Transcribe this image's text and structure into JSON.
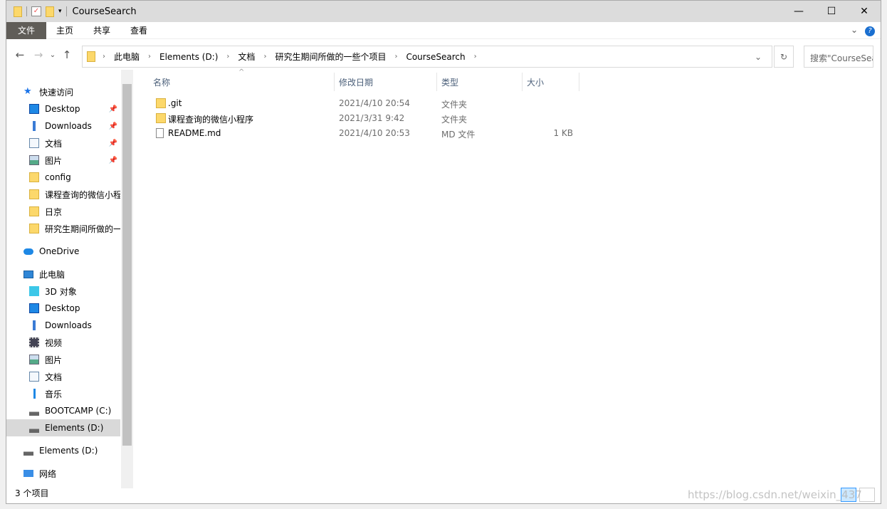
{
  "window": {
    "title": "CourseSearch",
    "minimize": "—",
    "maximize": "☐",
    "close": "✕"
  },
  "ribbon": {
    "tabs": [
      "文件",
      "主页",
      "共享",
      "查看"
    ],
    "help": "?",
    "expand": "⌄"
  },
  "nav": {
    "back": "←",
    "forward": "→",
    "recent": "⌄",
    "up": "↑",
    "refresh": "↻"
  },
  "address": {
    "crumbs": [
      "此电脑",
      "Elements (D:)",
      "文档",
      "研究生期间所做的一些个项目",
      "CourseSearch"
    ]
  },
  "search": {
    "placeholder": "搜索\"CourseSearch\""
  },
  "sidebar": {
    "items": [
      {
        "label": "快速访问",
        "icon": "star-icon",
        "pinned": false
      },
      {
        "label": "Desktop",
        "icon": "desktop-icon",
        "pinned": true
      },
      {
        "label": "Downloads",
        "icon": "download-icon",
        "pinned": true
      },
      {
        "label": "文档",
        "icon": "document-icon",
        "pinned": true
      },
      {
        "label": "图片",
        "icon": "picture-icon",
        "pinned": true
      },
      {
        "label": "config",
        "icon": "folder-icon"
      },
      {
        "label": "课程查询的微信小程序",
        "icon": "folder-icon"
      },
      {
        "label": "日京",
        "icon": "folder-icon"
      },
      {
        "label": "研究生期间所做的一些个项目",
        "icon": "folder-icon"
      },
      {
        "label": "OneDrive",
        "icon": "cloud-icon"
      },
      {
        "label": "此电脑",
        "icon": "computer-icon"
      },
      {
        "label": "3D 对象",
        "icon": "cube-icon"
      },
      {
        "label": "Desktop",
        "icon": "desktop-icon"
      },
      {
        "label": "Downloads",
        "icon": "download-icon"
      },
      {
        "label": "视频",
        "icon": "video-icon"
      },
      {
        "label": "图片",
        "icon": "picture-icon"
      },
      {
        "label": "文档",
        "icon": "document-icon"
      },
      {
        "label": "音乐",
        "icon": "music-icon"
      },
      {
        "label": "BOOTCAMP (C:)",
        "icon": "drive-icon"
      },
      {
        "label": "Elements (D:)",
        "icon": "drive-icon",
        "selected": true
      },
      {
        "label": "Elements (D:)",
        "icon": "drive-icon"
      },
      {
        "label": "网络",
        "icon": "network-icon"
      }
    ]
  },
  "columns": [
    "名称",
    "修改日期",
    "类型",
    "大小"
  ],
  "files": [
    {
      "name": ".git",
      "date": "2021/4/10 20:54",
      "type": "文件夹",
      "size": "",
      "icon": "folder-icon"
    },
    {
      "name": "课程查询的微信小程序",
      "date": "2021/3/31 9:42",
      "type": "文件夹",
      "size": "",
      "icon": "folder-icon"
    },
    {
      "name": "README.md",
      "date": "2021/4/10 20:53",
      "type": "MD 文件",
      "size": "1 KB",
      "icon": "file-icon"
    }
  ],
  "status": "3 个项目",
  "watermark": "https://blog.csdn.net/weixin_437"
}
